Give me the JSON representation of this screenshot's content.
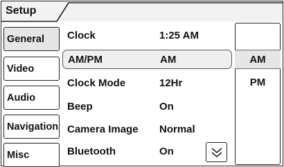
{
  "header": {
    "title": "Setup"
  },
  "nav": {
    "items": [
      {
        "label": "General",
        "active": true
      },
      {
        "label": "Video"
      },
      {
        "label": "Audio"
      },
      {
        "label": "Navigation"
      },
      {
        "label": "Misc"
      }
    ]
  },
  "settings": {
    "rows": [
      {
        "label": "Clock",
        "value": "1:25 AM"
      },
      {
        "label": "AM/PM",
        "value": "AM",
        "selected": true
      },
      {
        "label": "Clock Mode",
        "value": "12Hr"
      },
      {
        "label": "Beep",
        "value": "On"
      },
      {
        "label": "Camera Image",
        "value": "Normal"
      },
      {
        "label": "Bluetooth",
        "value": "On"
      }
    ]
  },
  "options": {
    "items": [
      {
        "label": "AM",
        "selected": true
      },
      {
        "label": "PM"
      }
    ]
  },
  "icons": {
    "scroll": "double-chevron-down-icon"
  }
}
